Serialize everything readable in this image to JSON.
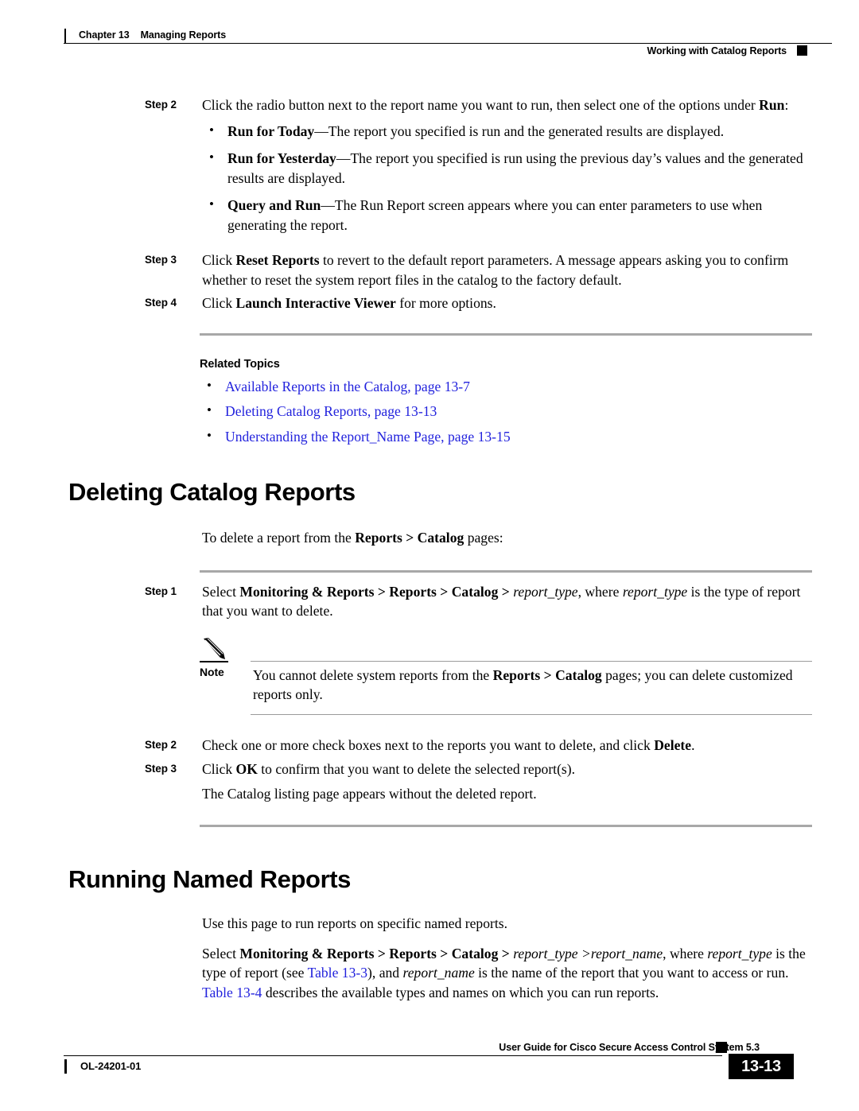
{
  "header": {
    "chapter_number": "Chapter 13",
    "chapter_title": "Managing Reports",
    "running_head": "Working with Catalog Reports"
  },
  "footer": {
    "book_title": "User Guide for Cisco Secure Access Control System 5.3",
    "doc_id": "OL-24201-01",
    "page_number": "13-13"
  },
  "colors": {
    "link": "#2222DD",
    "rule_grey": "#A8A8A8",
    "text": "#000000"
  },
  "body": {
    "step2_label": "Step 2",
    "step2_text_pre": "Click the radio button next to the report name you want to run, then select one of the options under ",
    "step2_text_bold": "Run",
    "step2_text_post": ":",
    "bullets": [
      {
        "term": "Run for Today",
        "dash": "—",
        "desc": "The report you specified is run and the generated results are displayed."
      },
      {
        "term": "Run for Yesterday",
        "dash": "—",
        "desc": "The report you specified is run using the previous day’s values and the generated results are displayed."
      },
      {
        "term": "Query and Run",
        "dash": "—",
        "desc": "The Run Report screen appears where you can enter parameters to use when generating the report."
      }
    ],
    "step3_label": "Step 3",
    "step3_pre": "Click ",
    "step3_bold": "Reset Reports",
    "step3_post": " to revert to the default report parameters. A message appears asking you to confirm whether to reset the system report files in the catalog to the factory default.",
    "step4_label": "Step 4",
    "step4_pre": "Click ",
    "step4_bold": "Launch Interactive Viewer",
    "step4_post": " for more options."
  },
  "related_topics": {
    "heading": "Related Topics",
    "links": [
      "Available Reports in the Catalog, page 13-7",
      "Deleting Catalog Reports, page 13-13",
      "Understanding the Report_Name Page, page 13-15"
    ]
  },
  "deleting_section": {
    "heading": "Deleting Catalog Reports",
    "intro_pre": "To delete a report from the ",
    "intro_bold": "Reports > Catalog",
    "intro_post": " pages:",
    "step1_label": "Step 1",
    "step1_pre": "Select ",
    "step1_bold": "Monitoring & Reports > Reports > Catalog > ",
    "step1_italic1": "report_type",
    "step1_mid": ", where ",
    "step1_italic2": "report_type",
    "step1_post": " is the type of report that you want to delete.",
    "note": {
      "icon": "pencil-icon",
      "label": "Note",
      "text_pre": "You cannot delete system reports from the ",
      "text_bold": "Reports > Catalog",
      "text_post": " pages; you can delete customized reports only."
    },
    "step2_label": "Step 2",
    "step2_pre": "Check one or more check boxes next to the reports you want to delete, and click ",
    "step2_bold": "Delete",
    "step2_post": ".",
    "step3_label": "Step 3",
    "step3_pre": "Click ",
    "step3_bold": "OK",
    "step3_post": " to confirm that you want to delete the selected report(s).",
    "result_text": "The Catalog listing page appears without the deleted report."
  },
  "running_section": {
    "heading": "Running Named Reports",
    "intro": "Use this page to run reports on specific named reports.",
    "body_pre": "Select ",
    "body_bold": "Monitoring & Reports > Reports > Catalog > ",
    "body_italic1": "report_type >report_name",
    "body_mid1": ", where ",
    "body_italic2": "report_type",
    "body_mid2": " is the type of report (see ",
    "body_link1": "Table 13-3",
    "body_mid3": "), and ",
    "body_italic3": "report_name",
    "body_mid4": " is the name of the report that you want to access or run. ",
    "body_link2": "Table 13-4",
    "body_post": " describes the available types and names on which you can run reports."
  }
}
